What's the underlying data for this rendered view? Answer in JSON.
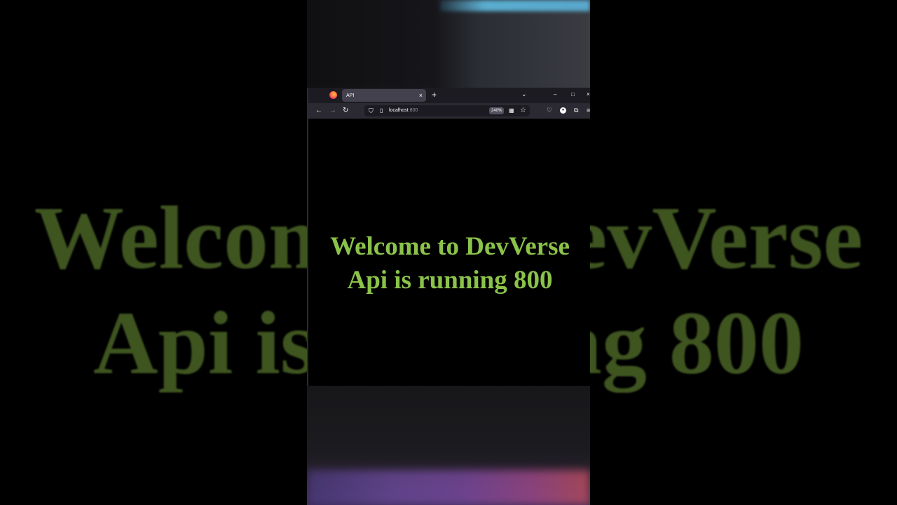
{
  "background": {
    "line1": "Welcome to DevVerse",
    "line2": "Api is running 800"
  },
  "browser": {
    "tab_title": "API",
    "tab_close": "×",
    "new_tab": "+",
    "tab_list": "⌄",
    "window": {
      "minimize": "–",
      "maximize": "□",
      "close": "×"
    },
    "nav": {
      "back": "←",
      "forward": "→",
      "reload": "↻"
    },
    "url_host": "localhost",
    "url_port": ":800",
    "zoom": "240%",
    "icons": {
      "shield": "shield-icon",
      "page": "page-icon",
      "qr": "qr-code-icon",
      "star": "bookmark-star-icon",
      "pocket": "pocket-icon",
      "account": "account-icon",
      "extensions": "extensions-icon",
      "menu": "hamburger-menu-icon"
    }
  },
  "page": {
    "heading": "Welcome to DevVerse",
    "status": "Api is running 800",
    "text_color": "#8bc34a"
  }
}
